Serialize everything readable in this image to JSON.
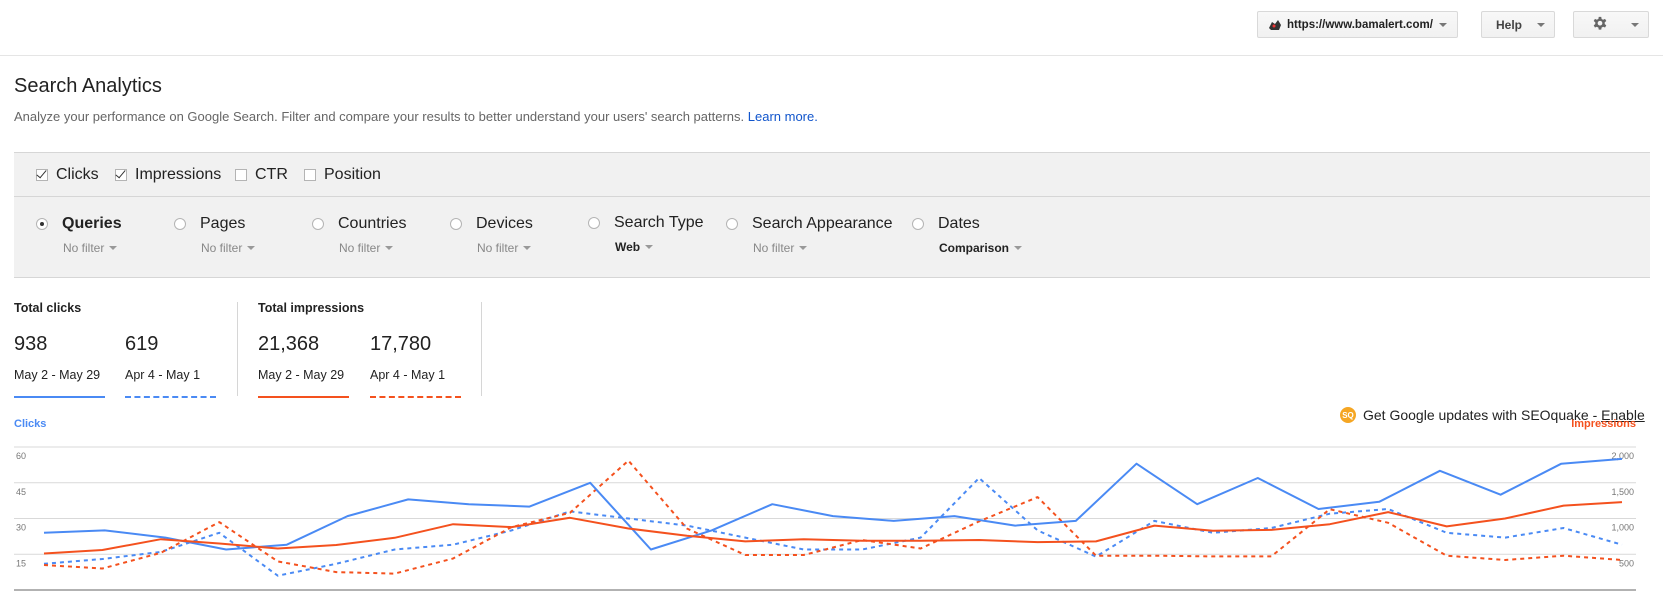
{
  "header": {
    "site_url": "https://www.bamalert.com/",
    "help_label": "Help"
  },
  "page": {
    "title": "Search Analytics",
    "description": "Analyze your performance on Google Search. Filter and compare your results to better understand your users' search patterns.",
    "learn_more": "Learn more."
  },
  "metrics": [
    {
      "label": "Clicks",
      "checked": true
    },
    {
      "label": "Impressions",
      "checked": true
    },
    {
      "label": "CTR",
      "checked": false
    },
    {
      "label": "Position",
      "checked": false
    }
  ],
  "dimensions": [
    {
      "label": "Queries",
      "filter": "No filter",
      "selected": true
    },
    {
      "label": "Pages",
      "filter": "No filter",
      "selected": false
    },
    {
      "label": "Countries",
      "filter": "No filter",
      "selected": false
    },
    {
      "label": "Devices",
      "filter": "No filter",
      "selected": false
    },
    {
      "label": "Search Type",
      "filter": "Web",
      "selected": false
    },
    {
      "label": "Search Appearance",
      "filter": "No filter",
      "selected": false
    },
    {
      "label": "Dates",
      "filter": "Comparison",
      "selected": false
    }
  ],
  "totals": {
    "clicks_title": "Total clicks",
    "impressions_title": "Total impressions",
    "clicks_current": "938",
    "clicks_previous": "619",
    "impressions_current": "21,368",
    "impressions_previous": "17,780",
    "range_current": "May 2 - May 29",
    "range_previous": "Apr 4 - May 1"
  },
  "seoquake": {
    "text": "Get Google updates with SEOquake -",
    "link": "Enable",
    "badge": "SQ"
  },
  "colors": {
    "clicks": "#4a8af4",
    "impressions": "#f4511e",
    "link": "#1155cc"
  },
  "chart_data": {
    "type": "line",
    "left_axis_label": "Clicks",
    "right_axis_label": "Impressions",
    "left_ticks": [
      "60",
      "45",
      "30",
      "15"
    ],
    "right_ticks": [
      "2,000",
      "1,500",
      "1,000",
      "500"
    ],
    "ylim_left": [
      0,
      60
    ],
    "ylim_right": [
      0,
      2000
    ],
    "series": [
      {
        "name": "Clicks",
        "period": "May 2 - May 29",
        "axis": "left",
        "dashed": false,
        "values": [
          24,
          25,
          22,
          17,
          19,
          31,
          38,
          36,
          35,
          45,
          17,
          25,
          36,
          31,
          29,
          31,
          27,
          29,
          53,
          36,
          47,
          34,
          37,
          50,
          40,
          53,
          55
        ]
      },
      {
        "name": "Clicks",
        "period": "Apr 4 - May 1",
        "axis": "left",
        "dashed": true,
        "values": [
          11,
          13,
          16,
          24,
          6,
          11,
          17,
          19,
          25,
          33,
          30,
          27,
          22,
          17,
          17,
          22,
          47,
          25,
          14,
          29,
          24,
          26,
          32,
          34,
          24,
          22,
          26,
          19
        ]
      },
      {
        "name": "Impressions",
        "period": "May 2 - May 29",
        "axis": "right",
        "dashed": false,
        "values": [
          510,
          560,
          710,
          650,
          580,
          630,
          730,
          920,
          880,
          1010,
          860,
          760,
          680,
          710,
          690,
          690,
          700,
          670,
          680,
          900,
          830,
          840,
          920,
          1090,
          890,
          1000,
          1180,
          1230
        ]
      },
      {
        "name": "Impressions",
        "period": "Apr 4 - May 1",
        "axis": "right",
        "dashed": true,
        "values": [
          350,
          300,
          520,
          950,
          400,
          250,
          230,
          440,
          880,
          1080,
          1810,
          860,
          490,
          490,
          700,
          580,
          960,
          1300,
          480,
          480,
          470,
          470,
          1130,
          940,
          480,
          420,
          480,
          420
        ]
      }
    ]
  }
}
